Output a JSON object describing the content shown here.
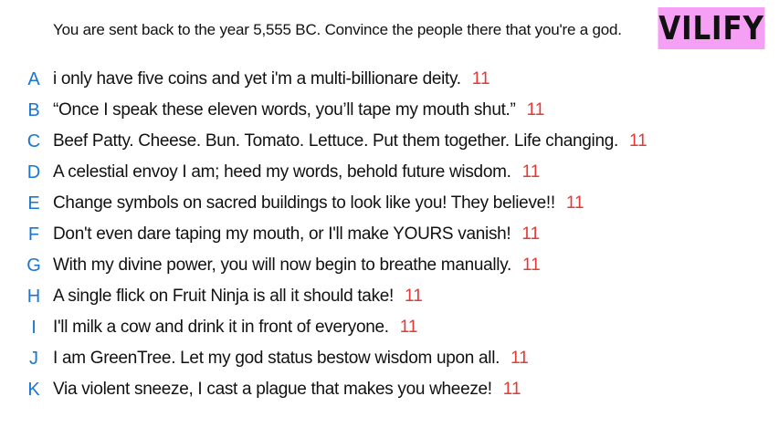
{
  "prompt": "You are sent back to the year 5,555 BC. Convince the people there that you're a god.",
  "mode_badge": {
    "label": "VILIFY",
    "background": "#f59ff5",
    "color": "#111111"
  },
  "colors": {
    "letter": "#1976d2",
    "votes": "#e53935",
    "text": "#111111"
  },
  "answers": [
    {
      "letter": "A",
      "text": "i only have five coins and yet i'm a multi-billionare deity.",
      "votes": "11"
    },
    {
      "letter": "B",
      "text": "“Once I speak these eleven words, you’ll tape my mouth shut.”",
      "votes": "11"
    },
    {
      "letter": "C",
      "text": "Beef Patty. Cheese. Bun. Tomato. Lettuce. Put them together. Life changing.",
      "votes": "11"
    },
    {
      "letter": "D",
      "text": "A celestial envoy I am; heed my words, behold future wisdom.",
      "votes": "11"
    },
    {
      "letter": "E",
      "text": "Change symbols on sacred buildings to look like you! They believe!!",
      "votes": "11"
    },
    {
      "letter": "F",
      "text": "Don't even dare taping my mouth, or I'll make YOURS vanish!",
      "votes": "11"
    },
    {
      "letter": "G",
      "text": "With my divine power, you will now begin to breathe manually.",
      "votes": "11"
    },
    {
      "letter": "H",
      "text": "A single flick on Fruit Ninja is all it should take!",
      "votes": "11"
    },
    {
      "letter": "I",
      "text": "I'll milk a cow and drink it in front of everyone.",
      "votes": "11"
    },
    {
      "letter": "J",
      "text": "I am GreenTree. Let my god status bestow wisdom upon all.",
      "votes": "11"
    },
    {
      "letter": "K",
      "text": "Via violent sneeze, I cast a plague that makes you wheeze!",
      "votes": "11"
    }
  ]
}
